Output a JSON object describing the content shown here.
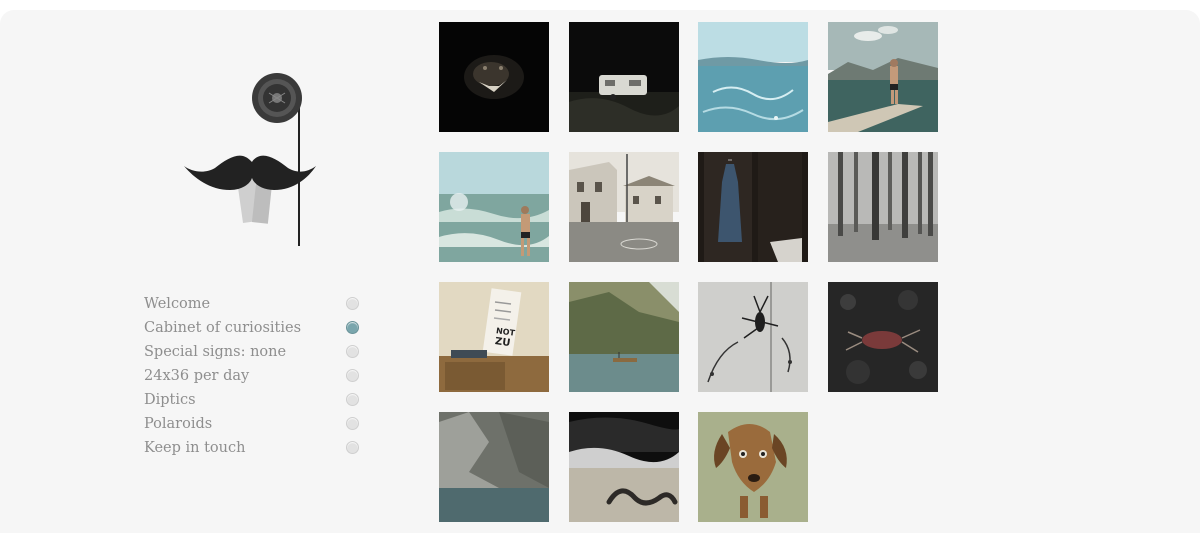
{
  "logo": {
    "icon": "mustache-monocle-icon"
  },
  "menu": {
    "items": [
      {
        "label": "Welcome",
        "active": false
      },
      {
        "label": "Cabinet of curiosities",
        "active": true
      },
      {
        "label": "Special signs: none",
        "active": false
      },
      {
        "label": "24x36 per day",
        "active": false
      },
      {
        "label": "Diptics",
        "active": false
      },
      {
        "label": "Polaroids",
        "active": false
      },
      {
        "label": "Keep in touch",
        "active": false
      }
    ],
    "active_dot_color": "#7aa6ad",
    "inactive_dot_color": "#e2e2e2"
  },
  "gallery": {
    "photos": [
      {
        "subject": "dark-animal-snarl-photo"
      },
      {
        "subject": "caravan-at-night-photo"
      },
      {
        "subject": "blue-sea-waves-photo"
      },
      {
        "subject": "man-on-pier-photo"
      },
      {
        "subject": "swimmer-in-sea-photo"
      },
      {
        "subject": "village-street-photo"
      },
      {
        "subject": "dress-in-wardrobe-photo"
      },
      {
        "subject": "bare-forest-photo"
      },
      {
        "subject": "eye-chart-desk-photo"
      },
      {
        "subject": "mountain-lake-boat-photo"
      },
      {
        "subject": "insect-on-wall-photo"
      },
      {
        "subject": "dead-bird-ground-photo"
      },
      {
        "subject": "rock-cliff-water-photo"
      },
      {
        "subject": "octopus-tentacle-beach-photo"
      },
      {
        "subject": "dachshund-dog-photo"
      }
    ],
    "eye_chart_text": [
      "NOT",
      "ZU"
    ]
  }
}
